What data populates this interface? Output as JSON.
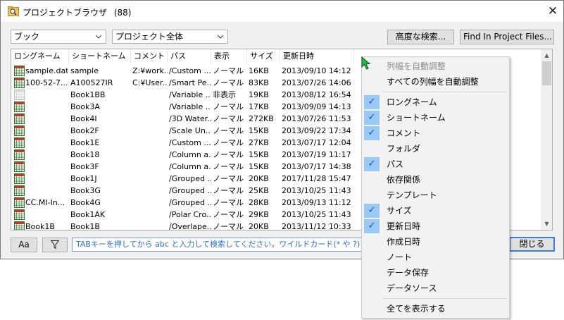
{
  "window": {
    "title": "プロジェクトブラウザ",
    "count": "(88)",
    "close_label": "✕"
  },
  "toolbar": {
    "book_select": "ブック",
    "scope_select": "プロジェクト全体",
    "advanced_search": "高度な検索...",
    "find_in_project": "Find In Project Files..."
  },
  "table": {
    "columns": [
      "ロングネーム",
      "ショートネーム",
      "コメント",
      "パス",
      "表示",
      "サイズ",
      "更新日時"
    ],
    "rows": [
      {
        "long": "sample.dat",
        "short": "sample",
        "comment": "Z:¥work...",
        "path": "/Custom ...",
        "display": "ノーマル",
        "size": "16KB",
        "modified": "2013/09/10 14:12",
        "icon": "book-icon"
      },
      {
        "long": "100-52-7...",
        "short": "A100527IR",
        "comment": "C:¥User...",
        "path": "/Smart Pe...",
        "display": "ノーマル",
        "size": "83KB",
        "modified": "2013/07/26 14:06",
        "icon": "book-icon"
      },
      {
        "long": "",
        "short": "Book1BB",
        "comment": "",
        "path": "/Variable ...",
        "display": "非表示",
        "size": "19KB",
        "modified": "2013/08/12 16:54",
        "icon": "hidden-book-icon"
      },
      {
        "long": "",
        "short": "Book3A",
        "comment": "",
        "path": "/Variable ...",
        "display": "ノーマル",
        "size": "17KB",
        "modified": "2013/09/09 14:13",
        "icon": "book-icon"
      },
      {
        "long": "",
        "short": "Book4I",
        "comment": "",
        "path": "/3D Water...",
        "display": "ノーマル",
        "size": "272KB",
        "modified": "2013/07/26 11:53",
        "icon": "book-icon"
      },
      {
        "long": "",
        "short": "Book2F",
        "comment": "",
        "path": "/Scale Un...",
        "display": "ノーマル",
        "size": "15KB",
        "modified": "2013/09/22 17:34",
        "icon": "book-icon"
      },
      {
        "long": "",
        "short": "Book1E",
        "comment": "",
        "path": "/Custom ...",
        "display": "ノーマル",
        "size": "27KB",
        "modified": "2013/07/17 12:04",
        "icon": "book-icon"
      },
      {
        "long": "",
        "short": "Book18",
        "comment": "",
        "path": "/Column a...",
        "display": "ノーマル",
        "size": "15KB",
        "modified": "2013/07/19 11:17",
        "icon": "book-icon"
      },
      {
        "long": "",
        "short": "Book3F",
        "comment": "",
        "path": "/Column a...",
        "display": "ノーマル",
        "size": "15KB",
        "modified": "2013/07/17 14:38",
        "icon": "book-icon"
      },
      {
        "long": "",
        "short": "Book1J",
        "comment": "",
        "path": "/Grouped ...",
        "display": "ノーマル",
        "size": "20KB",
        "modified": "2017/11/28 15:47",
        "icon": "book-icon"
      },
      {
        "long": "",
        "short": "Book3G",
        "comment": "",
        "path": "/Grouped ...",
        "display": "ノーマル",
        "size": "25KB",
        "modified": "2013/10/25 11:43",
        "icon": "book-icon"
      },
      {
        "long": "CC.MI-In...",
        "short": "Book4G",
        "comment": "",
        "path": "/Grouped ...",
        "display": "ノーマル",
        "size": "28KB",
        "modified": "2013/09/13 11:12",
        "icon": "book-icon"
      },
      {
        "long": "",
        "short": "Book1AK",
        "comment": "",
        "path": "/Polar Cro...",
        "display": "ノーマル",
        "size": "29KB",
        "modified": "2013/10/25 11:43",
        "icon": "book-icon"
      },
      {
        "long": "Book1B",
        "short": "Book1B",
        "comment": "",
        "path": "/Overlape...",
        "display": "ノーマル",
        "size": "20KB",
        "modified": "2013/11/12 10:33",
        "icon": "book-icon"
      }
    ]
  },
  "bottom": {
    "case_button": "Aa",
    "search_placeholder": "TABキーを押してから abc と入力して検索してください。ワイルドカード(* や ?)を使",
    "close_button": "閉じる"
  },
  "context_menu": {
    "items": [
      {
        "label": "列幅を自動調整",
        "checked": false,
        "disabled": true
      },
      {
        "label": "すべての列幅を自動調整",
        "checked": false,
        "disabled": false
      },
      {
        "separator": true
      },
      {
        "label": "ロングネーム",
        "checked": true,
        "disabled": false
      },
      {
        "label": "ショートネーム",
        "checked": true,
        "disabled": false
      },
      {
        "label": "コメント",
        "checked": true,
        "disabled": false
      },
      {
        "label": "フォルダ",
        "checked": false,
        "disabled": false
      },
      {
        "label": "パス",
        "checked": true,
        "disabled": false
      },
      {
        "label": "依存関係",
        "checked": false,
        "disabled": false
      },
      {
        "label": "テンプレート",
        "checked": false,
        "disabled": false
      },
      {
        "label": "サイズ",
        "checked": true,
        "disabled": false
      },
      {
        "label": "更新日時",
        "checked": true,
        "disabled": false
      },
      {
        "label": "作成日時",
        "checked": false,
        "disabled": false
      },
      {
        "label": "ノート",
        "checked": false,
        "disabled": false
      },
      {
        "label": "データ保存",
        "checked": false,
        "disabled": false
      },
      {
        "label": "データソース",
        "checked": false,
        "disabled": false
      },
      {
        "separator": true
      },
      {
        "label": "全てを表示する",
        "checked": false,
        "disabled": false
      }
    ]
  },
  "colors": {
    "accent": "#3d7edb",
    "check_bg": "#99c9f6",
    "link_text": "#2c6fc7"
  }
}
